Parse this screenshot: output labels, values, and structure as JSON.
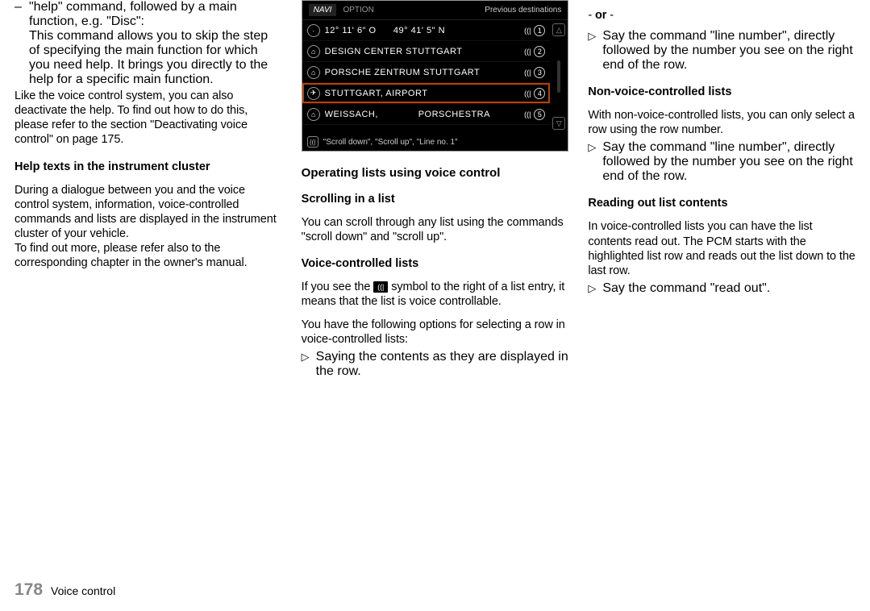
{
  "footer": {
    "page_number": "178",
    "title": "Voice control"
  },
  "col1": {
    "bullet_text": "\"help\" command, followed by a main function, e.g. \"Disc\":\nThis command allows you to skip the step of specifying the main function for which you need help. It brings you directly to the help for a specific main function.",
    "para1": "Like the voice control system, you can also deactivate the help. To find out how to do this, please refer to the section \"Deactivating voice control\" on page 175.",
    "h3a": "Help texts in the instrument cluster",
    "para2": "During a dialogue between you and the voice control system, information, voice-controlled commands and lists are displayed in the instrument cluster of your vehicle.\nTo find out more, please refer also to the corresponding chapter in the owner's manual."
  },
  "screenshot": {
    "navi": "NAVI",
    "option": "OPTION",
    "prev_dest": "Previous destinations",
    "rows": [
      {
        "icon": "·",
        "label": "12° 11' 6\" O      49° 41' 5\" N",
        "n": "1"
      },
      {
        "icon": "⌂",
        "label": "DESIGN CENTER STUTTGART",
        "n": "2"
      },
      {
        "icon": "⌂",
        "label": "PORSCHE ZENTRUM STUTTGART",
        "n": "3"
      },
      {
        "icon": "✈",
        "label": "STUTTGART, AIRPORT",
        "n": "4",
        "sel": true
      },
      {
        "icon": "⌂",
        "label": "WEISSACH,              PORSCHESTRA",
        "n": "5"
      }
    ],
    "foot": "\"Scroll down\", \"Scroll up\", \"Line no. 1\""
  },
  "col2": {
    "h2": "Operating lists using voice control",
    "h3a": "Scrolling in a list",
    "p1": "You can scroll through any list using the commands \"scroll down\" and \"scroll up\".",
    "h3b": "Voice-controlled lists",
    "p2a": "If you see the ",
    "p2b": " symbol to the right of a list entry, it means that the list is voice controllable.",
    "p3": "You have the following options for selecting a row in voice-controlled lists:",
    "li1": "Saying the contents as they are displayed in the row."
  },
  "col3": {
    "or": "- or -",
    "li1": "Say the command \"line number\", directly followed by the number you see on the right end of the row.",
    "h3a": "Non-voice-controlled lists",
    "p1": "With non-voice-controlled lists, you can only select a row using the row number.",
    "li2": "Say the command \"line number\", directly followed by the number you see on the right end of the row.",
    "h3b": "Reading out list contents",
    "p2": "In voice-controlled lists you can have the list contents read out. The PCM starts with the highlighted list row and reads out the list down to the last row.",
    "li3": "Say the command \"read out\"."
  }
}
